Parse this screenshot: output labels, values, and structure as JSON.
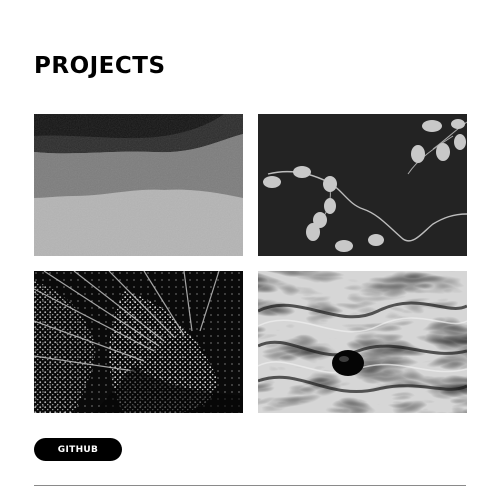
{
  "page": {
    "title": "PROJECTS"
  },
  "projects": [
    {
      "image": "landscape-hills-image"
    },
    {
      "image": "branch-leaves-image"
    },
    {
      "image": "speckled-pattern-image"
    },
    {
      "image": "marble-swirl-image"
    }
  ],
  "links": {
    "github_label": "GITHUB"
  },
  "colors": {
    "background": "#ffffff",
    "text": "#000000",
    "button_bg": "#000000",
    "button_text": "#ffffff",
    "divider": "#8a8a8a"
  }
}
